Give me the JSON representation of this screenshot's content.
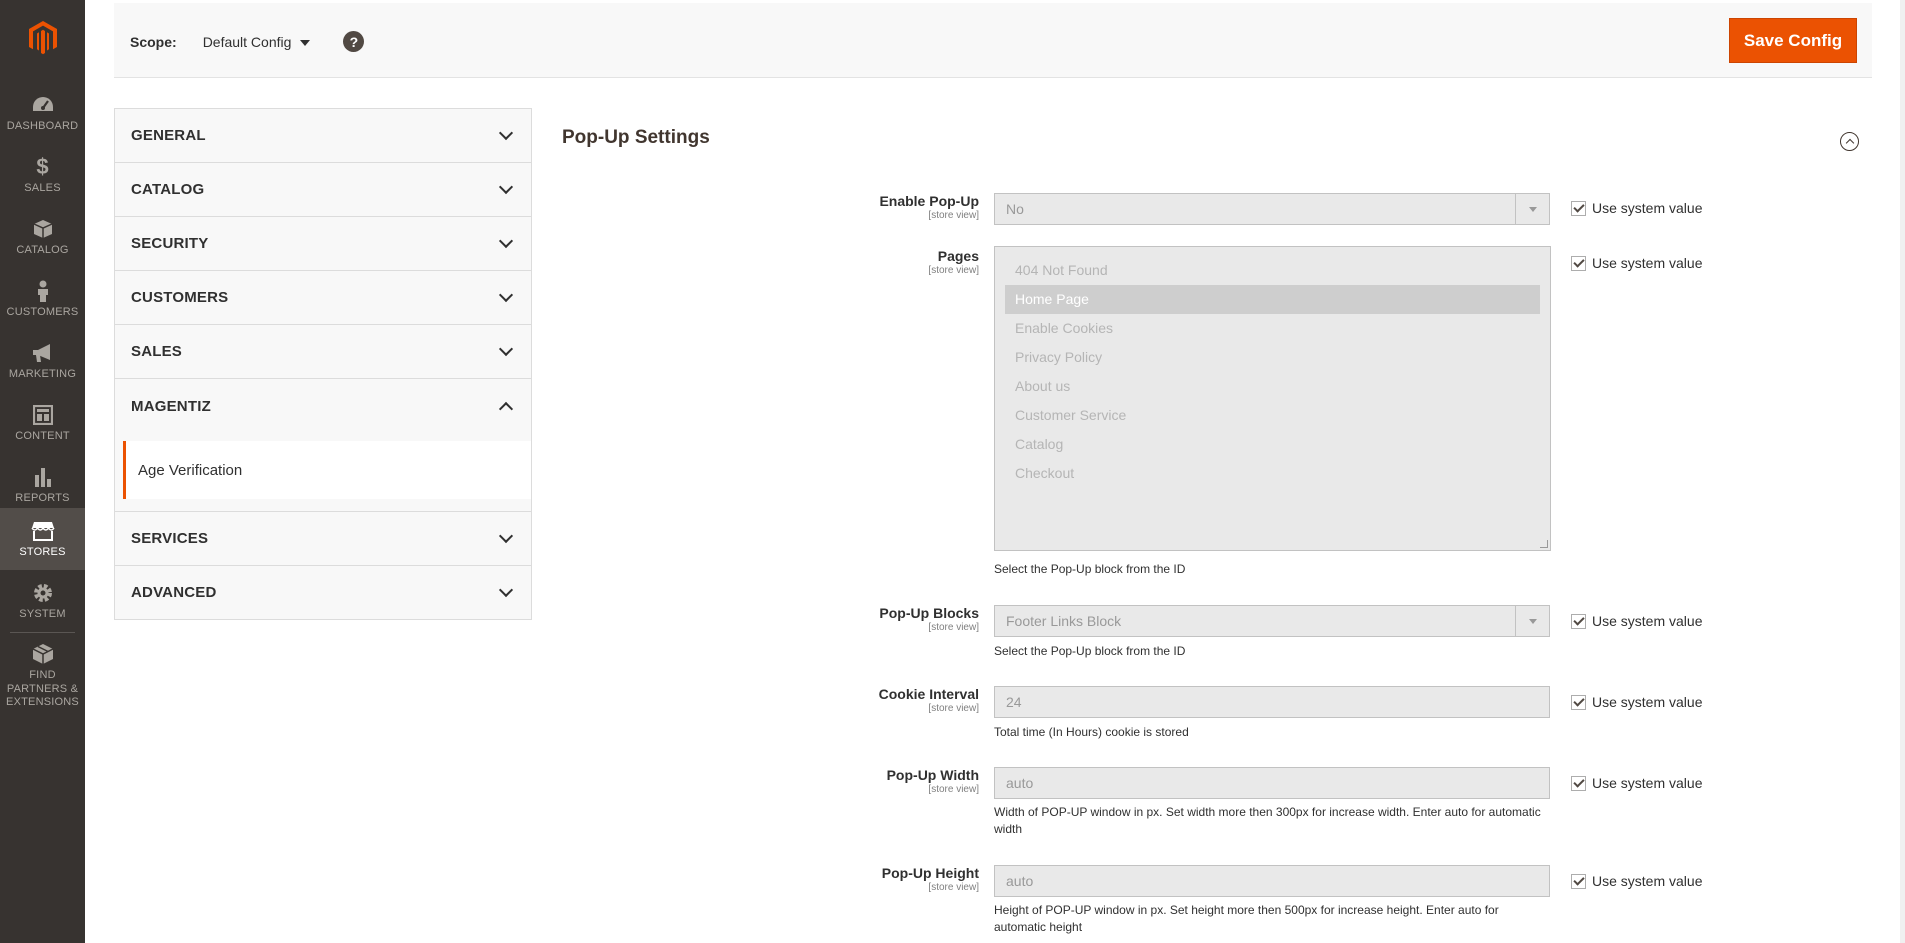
{
  "nav": {
    "items": [
      {
        "label": "DASHBOARD",
        "icon": "dashboard-icon"
      },
      {
        "label": "SALES",
        "icon": "dollar-icon"
      },
      {
        "label": "CATALOG",
        "icon": "box-icon"
      },
      {
        "label": "CUSTOMERS",
        "icon": "person-icon"
      },
      {
        "label": "MARKETING",
        "icon": "megaphone-icon"
      },
      {
        "label": "CONTENT",
        "icon": "layout-icon"
      },
      {
        "label": "REPORTS",
        "icon": "bar-chart-icon"
      },
      {
        "label": "STORES",
        "icon": "store-icon"
      },
      {
        "label": "SYSTEM",
        "icon": "gear-icon"
      },
      {
        "label": "FIND PARTNERS & EXTENSIONS",
        "icon": "partners-icon"
      }
    ],
    "active": "STORES"
  },
  "header": {
    "scope_label": "Scope:",
    "scope_value": "Default Config",
    "help": "?",
    "save_label": "Save Config"
  },
  "tabs": {
    "items": [
      "GENERAL",
      "CATALOG",
      "SECURITY",
      "CUSTOMERS",
      "SALES",
      "MAGENTIZ",
      "SERVICES",
      "ADVANCED"
    ],
    "expanded": "MAGENTIZ",
    "subitem": "Age Verification"
  },
  "section": {
    "title": "Pop-Up Settings"
  },
  "fields": {
    "scope_note": "[store view]",
    "use_system_value": "Use system value",
    "enable_popup": {
      "label": "Enable Pop-Up",
      "value": "No"
    },
    "pages": {
      "label": "Pages",
      "options": [
        "404 Not Found",
        "Home Page",
        "Enable Cookies",
        "Privacy Policy",
        "About us",
        "Customer Service",
        "Catalog",
        "Checkout"
      ],
      "selected": "Home Page",
      "note": "Select the Pop-Up block from the ID"
    },
    "popup_blocks": {
      "label": "Pop-Up Blocks",
      "value": "Footer Links Block",
      "note": "Select the Pop-Up block from the ID"
    },
    "cookie_interval": {
      "label": "Cookie Interval",
      "value": "24",
      "note": "Total time (In Hours) cookie is stored"
    },
    "popup_width": {
      "label": "Pop-Up Width",
      "value": "auto",
      "note": "Width of POP-UP window in px. Set width more then 300px for increase width. Enter auto for automatic width"
    },
    "popup_height": {
      "label": "Pop-Up Height",
      "value": "auto",
      "note": "Height of POP-UP window in px. Set height more then 500px for increase height. Enter auto for automatic height"
    }
  }
}
